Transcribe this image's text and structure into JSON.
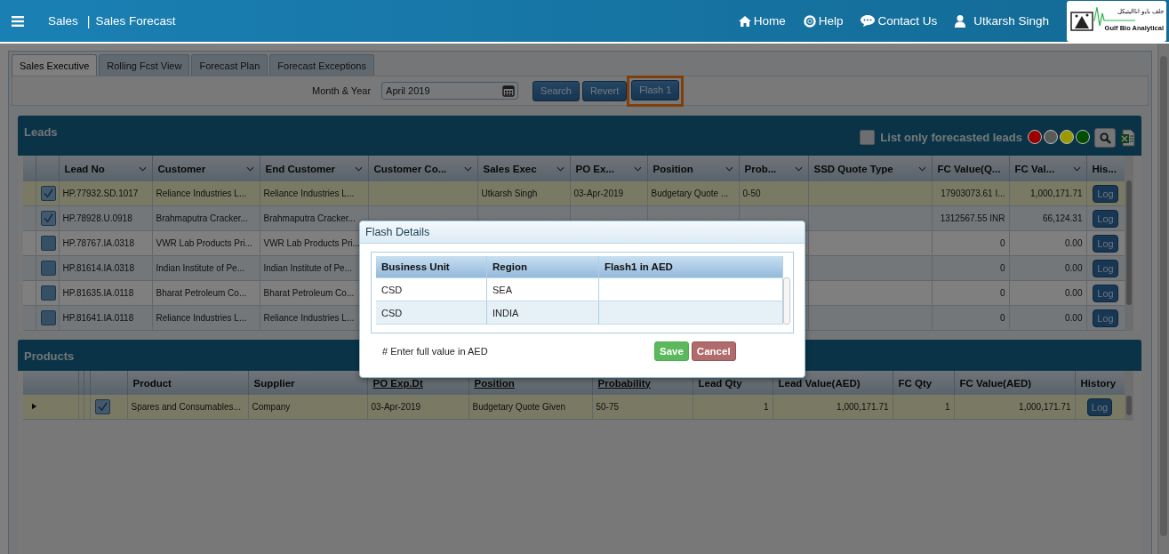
{
  "header": {
    "section": "Sales",
    "separator": "|",
    "page": "Sales Forecast",
    "nav": [
      {
        "label": "Home",
        "kind": "home"
      },
      {
        "label": "Help",
        "kind": "help"
      },
      {
        "label": "Contact Us",
        "kind": "chat"
      },
      {
        "label": "Utkarsh Singh",
        "kind": "user"
      }
    ],
    "logo": {
      "arabic": "جلف بايو انااليتيكل",
      "name": "Gulf Bio Analytical"
    }
  },
  "tabs": [
    {
      "label": "Sales Executive",
      "selected": true
    },
    {
      "label": "Rolling Fcst View",
      "selected": false
    },
    {
      "label": "Forecast Plan",
      "selected": false
    },
    {
      "label": "Forecast Exceptions",
      "selected": false
    }
  ],
  "filter": {
    "label": "Month & Year",
    "value": "April 2019"
  },
  "buttons": [
    {
      "label": "Search",
      "highlighted": false
    },
    {
      "label": "Revert",
      "highlighted": false
    },
    {
      "label": "Flash 1",
      "highlighted": true
    }
  ],
  "leads": {
    "title": "Leads",
    "only_forecasted": {
      "label": "List only forecasted leads",
      "checked": false
    },
    "status_dots": [
      {
        "color": "#9a0000"
      },
      {
        "color": "#5a5a5a"
      },
      {
        "color": "#9a9a00"
      },
      {
        "color": "#004d00"
      }
    ],
    "columns": [
      {
        "label": "Lead No",
        "menu": true
      },
      {
        "label": "Customer",
        "menu": true
      },
      {
        "label": "End Customer",
        "menu": true
      },
      {
        "label": "Customer Co...",
        "menu": true
      },
      {
        "label": "Sales Exec",
        "menu": true
      },
      {
        "label": "PO Ex...",
        "menu": true
      },
      {
        "label": "Position",
        "menu": true
      },
      {
        "label": "Prob...",
        "menu": true
      },
      {
        "label": "SSD Quote Type",
        "menu": true
      },
      {
        "label": "FC Value(Q...",
        "menu": false
      },
      {
        "label": "FC Val...",
        "menu": true
      },
      {
        "label": "His...",
        "menu": false
      }
    ],
    "rows": [
      {
        "checked": true,
        "selected": true,
        "cells": [
          "HP.77932.SD.1017",
          "Reliance Industries L...",
          "Reliance Industries L...",
          null,
          "Utkarsh Singh",
          "03-Apr-2019",
          "Budgetary Quote ...",
          "0-50",
          null,
          "17903073.61 I...",
          "1,000,171.71"
        ],
        "action": "Log"
      },
      {
        "checked": true,
        "selected": false,
        "cells": [
          "HP.78928.U.0918",
          "Brahmaputra Cracker...",
          "Brahmaputra Cracker...",
          null,
          null,
          null,
          null,
          null,
          null,
          "1312567.55 INR",
          "66,124.31"
        ],
        "action": "Log"
      },
      {
        "checked": false,
        "selected": false,
        "cells": [
          "HP.78767.IA.0318",
          "VWR Lab Products Pri...",
          "VWR Lab Products Pri...",
          null,
          null,
          null,
          null,
          null,
          null,
          "0",
          "0.00"
        ],
        "action": "Log"
      },
      {
        "checked": false,
        "selected": false,
        "cells": [
          "HP.81614.IA.0318",
          "Indian Institute of Pe...",
          "Indian Institute of Pe...",
          null,
          null,
          null,
          null,
          null,
          null,
          "0",
          "0.00"
        ],
        "action": "Log"
      },
      {
        "checked": false,
        "selected": false,
        "cells": [
          "HP.81635.IA.0118",
          "Bharat Petroleum Co...",
          "Bharat Petroleum Co...",
          null,
          null,
          null,
          null,
          null,
          null,
          "0",
          "0.00"
        ],
        "action": "Log"
      },
      {
        "checked": false,
        "selected": false,
        "cells": [
          "HP.81641.IA.0118",
          "Reliance Industries L...",
          "Reliance Industries L...",
          null,
          null,
          null,
          null,
          null,
          null,
          "0",
          "0.00"
        ],
        "action": "Log"
      }
    ]
  },
  "products": {
    "title": "Products",
    "columns": [
      {
        "label": "Product",
        "sortable": false
      },
      {
        "label": "Supplier",
        "sortable": false
      },
      {
        "label": "PO Exp.Dt",
        "sortable": true
      },
      {
        "label": "Position",
        "sortable": true
      },
      {
        "label": "Probability",
        "sortable": true
      },
      {
        "label": "Lead Qty",
        "sortable": false
      },
      {
        "label": "Lead Value(AED)",
        "sortable": false
      },
      {
        "label": "FC Qty",
        "sortable": false
      },
      {
        "label": "FC Value(AED)",
        "sortable": false
      },
      {
        "label": "History",
        "sortable": false
      }
    ],
    "rows": [
      {
        "expanded": false,
        "checked": true,
        "selected": true,
        "cells": [
          "Spares and Consumables...",
          "Company",
          "03-Apr-2019",
          "Budgetary Quote Given",
          "50-75",
          "1",
          "1,000,171.71",
          "1",
          "1,000,171.71"
        ],
        "action": "Log"
      }
    ]
  },
  "dialog": {
    "title": "Flash Details",
    "columns": [
      "Business Unit",
      "Region",
      "Flash1 in AED"
    ],
    "rows": [
      [
        "CSD",
        "SEA"
      ],
      [
        "CSD",
        "INDIA"
      ]
    ],
    "note": "# Enter full value in AED",
    "save": "Save",
    "cancel": "Cancel"
  }
}
